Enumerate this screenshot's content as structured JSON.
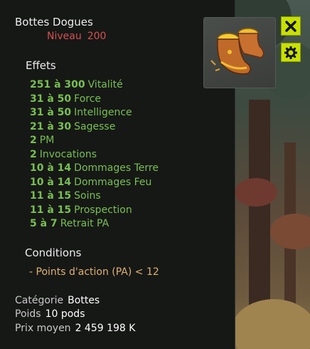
{
  "item": {
    "name": "Bottes Dogues",
    "level_label": "Niveau",
    "level_value": "200"
  },
  "effects_title": "Effets",
  "effects": [
    {
      "value": "251 à 300",
      "stat": "Vitalité"
    },
    {
      "value": "31 à 50",
      "stat": "Force"
    },
    {
      "value": "31 à 50",
      "stat": "Intelligence"
    },
    {
      "value": "21 à 30",
      "stat": "Sagesse"
    },
    {
      "value": "2",
      "stat": "PM"
    },
    {
      "value": "2",
      "stat": "Invocations"
    },
    {
      "value": "10 à 14",
      "stat": "Dommages Terre"
    },
    {
      "value": "10 à 14",
      "stat": "Dommages Feu"
    },
    {
      "value": "11 à 15",
      "stat": "Soins"
    },
    {
      "value": "11 à 15",
      "stat": "Prospection"
    },
    {
      "value": "5 à 7",
      "stat": "Retrait PA"
    }
  ],
  "conditions_title": "Conditions",
  "conditions": [
    "- Points d'action (PA) < 12"
  ],
  "meta": {
    "category_label": "Catégorie",
    "category_value": "Bottes",
    "weight_label": "Poids",
    "weight_value": "10 pods",
    "price_label": "Prix moyen",
    "price_value": "2 459 198 K"
  },
  "buttons": {
    "close_icon": "close-icon",
    "settings_icon": "gear-icon"
  },
  "colors": {
    "effect_green": "#78c050",
    "level_red": "#d65050",
    "condition_orange": "#e0b070",
    "button_yellow": "#c8e000"
  }
}
